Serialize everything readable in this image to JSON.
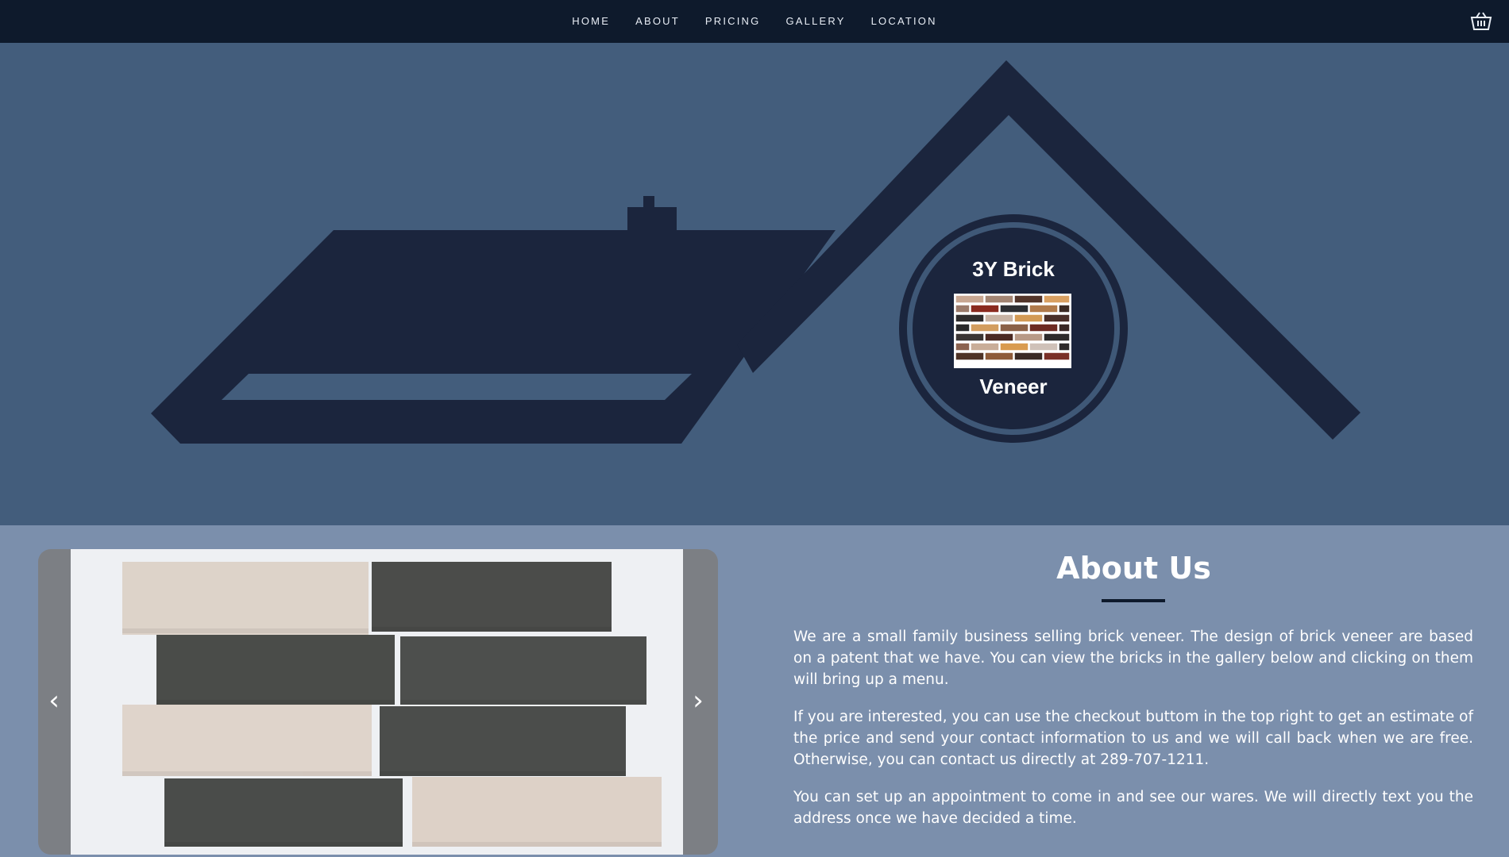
{
  "nav": {
    "items": [
      "HOME",
      "ABOUT",
      "PRICING",
      "GALLERY",
      "LOCATION"
    ],
    "cart_icon": "basket-icon"
  },
  "logo": {
    "line1": "3Y Brick",
    "line2": "Veneer"
  },
  "carousel": {
    "prev": "‹",
    "next": "›"
  },
  "about": {
    "title": "About Us",
    "paragraphs": [
      "We are a small family business selling brick veneer. The design of brick veneer are based on a patent that we have. You can view the bricks in the gallery below and clicking on them will bring up a menu.",
      "If you are interested, you can use the checkout buttom in the top right to get an estimate of the price and send your contact information to us and we will call back when we are free. Otherwise, you can contact us directly at 289-707-1211.",
      "You can set up an appointment to come in and see our wares. We will directly text you the address once we have decided a time."
    ]
  },
  "colors": {
    "nav_bg": "#0e1a2c",
    "hero_bg": "#435d7c",
    "house": "#1b253d",
    "section_bg": "#7b8fac"
  }
}
